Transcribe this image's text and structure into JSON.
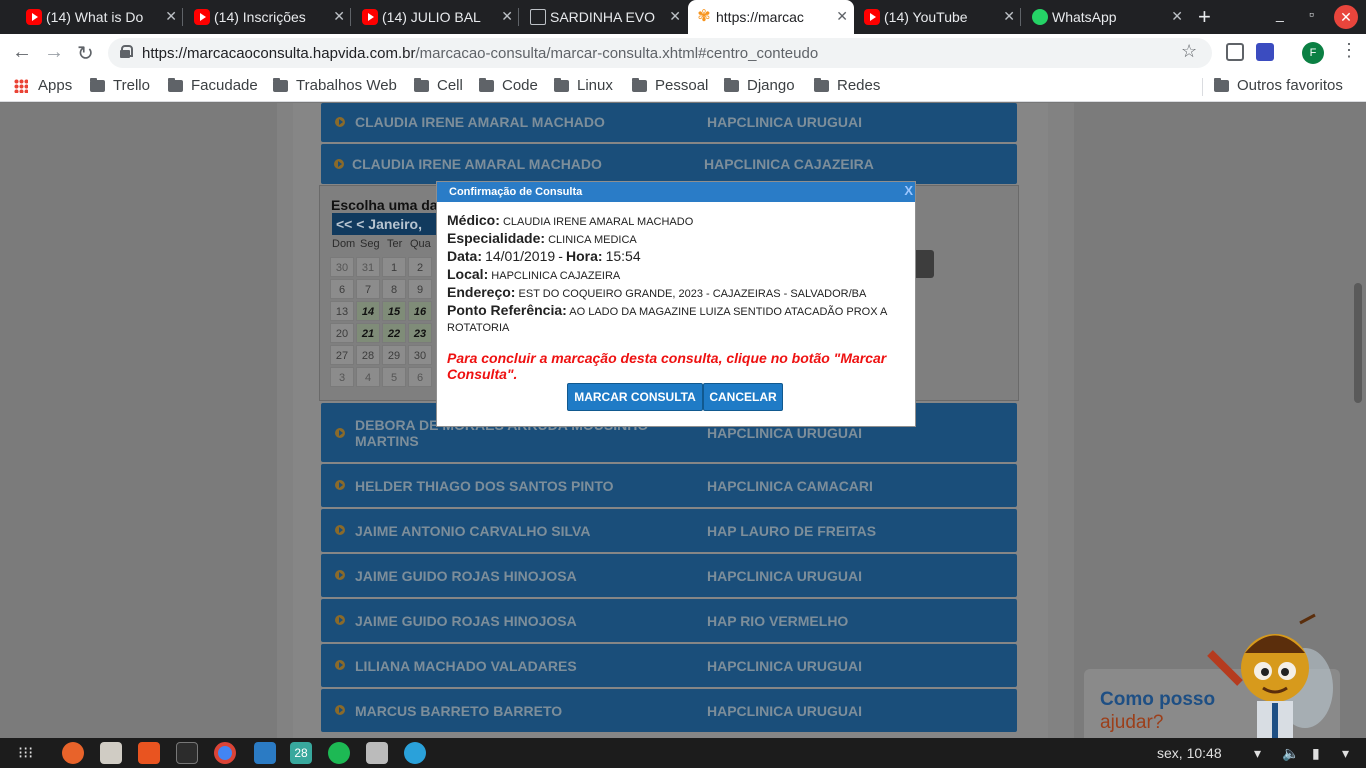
{
  "browser": {
    "tabs": [
      {
        "label": "(14) What is Do",
        "icon": "youtube-icon"
      },
      {
        "label": "(14) Inscrições",
        "icon": "youtube-icon"
      },
      {
        "label": "(14) JULIO BAL",
        "icon": "youtube-icon"
      },
      {
        "label": "SARDINHA EVO",
        "icon": "document-icon"
      },
      {
        "label": "https://marcac",
        "icon": "hapvida-icon"
      },
      {
        "label": "(14) YouTube",
        "icon": "youtube-icon"
      },
      {
        "label": "WhatsApp",
        "icon": "whatsapp-icon"
      }
    ],
    "url_host": "https://marcacaoconsulta.hapvida.com.br",
    "url_path": "/marcacao-consulta/marcar-consulta.xhtml#centro_conteudo",
    "profile_initial": "F",
    "bookmarks": [
      "Apps",
      "Trello",
      "Facudade",
      "Trabalhos Web",
      "Cell",
      "Code",
      "Linux",
      "Pessoal",
      "Django",
      "Redes"
    ],
    "other_bookmarks": "Outros favoritos"
  },
  "list": {
    "rows_top": [
      {
        "doctor": "CLAUDIA IRENE AMARAL MACHADO",
        "clinic": "HAPCLINICA URUGUAI"
      },
      {
        "doctor": "CLAUDIA IRENE AMARAL MACHADO",
        "clinic": "HAPCLINICA CAJAZEIRA"
      }
    ],
    "rows_bottom": [
      {
        "doctor": "DEBORA DE MORAES ARRUDA MOUSINHO MARTINS",
        "clinic": "HAPCLINICA URUGUAI"
      },
      {
        "doctor": "HELDER THIAGO DOS SANTOS PINTO",
        "clinic": "HAPCLINICA CAMACARI"
      },
      {
        "doctor": "JAIME ANTONIO CARVALHO SILVA",
        "clinic": "HAP LAURO DE FREITAS"
      },
      {
        "doctor": "JAIME GUIDO ROJAS HINOJOSA",
        "clinic": "HAPCLINICA URUGUAI"
      },
      {
        "doctor": "JAIME GUIDO ROJAS HINOJOSA",
        "clinic": "HAP RIO VERMELHO"
      },
      {
        "doctor": "LILIANA MACHADO VALADARES",
        "clinic": "HAPCLINICA URUGUAI"
      },
      {
        "doctor": "MARCUS BARRETO BARRETO",
        "clinic": "HAPCLINICA URUGUAI"
      }
    ]
  },
  "calendar": {
    "title": "Escolha uma da",
    "header": "<<  <  Janeiro,",
    "weekdays": [
      "Dom",
      "Seg",
      "Ter",
      "Qua"
    ],
    "weeks": [
      [
        "30",
        "31",
        "1",
        "2"
      ],
      [
        "6",
        "7",
        "8",
        "9"
      ],
      [
        "13",
        "14",
        "15",
        "16"
      ],
      [
        "20",
        "21",
        "22",
        "23"
      ],
      [
        "27",
        "28",
        "29",
        "30"
      ],
      [
        "3",
        "4",
        "5",
        "6"
      ]
    ]
  },
  "modal": {
    "title": "Confirmação de Consulta",
    "close": "X",
    "medico_label": "Médico:",
    "medico": "CLAUDIA IRENE AMARAL MACHADO",
    "especialidade_label": "Especialidade:",
    "especialidade": "CLINICA MEDICA",
    "data_label": "Data:",
    "data": "14/01/2019",
    "hora_sep": "-",
    "hora_label": "Hora:",
    "hora": "15:54",
    "local_label": "Local:",
    "local": "HAPCLINICA CAJAZEIRA",
    "endereco_label": "Endereço:",
    "endereco": "EST DO COQUEIRO GRANDE, 2023 - CAJAZEIRAS - SALVADOR/BA",
    "referencia_label": "Ponto Referência:",
    "referencia": "AO LADO DA MAGAZINE LUIZA SENTIDO ATACADÃO PROX A ROTATORIA",
    "notice": "Para concluir a marcação desta consulta, clique no botão \"Marcar Consulta\".",
    "confirm_button": "MARCAR CONSULTA",
    "cancel_button": "CANCELAR"
  },
  "chat": {
    "line1": "Como posso",
    "line2": "ajudar?"
  },
  "taskbar": {
    "workspace": "28",
    "clock": "sex, 10:48"
  }
}
